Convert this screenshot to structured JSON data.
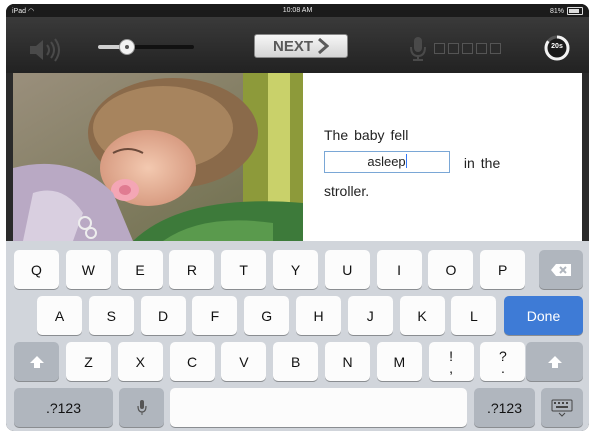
{
  "status_bar": {
    "carrier": "iPad",
    "time": "10:08 AM",
    "battery": "81%"
  },
  "toolbar": {
    "next_label": "NEXT",
    "volume_level": 0.3,
    "mic_level_boxes": 5,
    "timer_label": "20s",
    "timer_progress": 0.85
  },
  "exercise": {
    "words_before": [
      "The",
      "baby",
      "fell"
    ],
    "answer_value": "asleep",
    "words_after": [
      "in",
      "the"
    ],
    "line3": "stroller."
  },
  "keyboard": {
    "row1": [
      "Q",
      "W",
      "E",
      "R",
      "T",
      "Y",
      "U",
      "I",
      "O",
      "P"
    ],
    "row2": [
      "A",
      "S",
      "D",
      "F",
      "G",
      "H",
      "J",
      "K",
      "L"
    ],
    "done_label": "Done",
    "row3": [
      "Z",
      "X",
      "C",
      "V",
      "B",
      "N",
      "M"
    ],
    "row3_punct": [
      [
        "!",
        ","
      ],
      [
        "?",
        "."
      ]
    ],
    "numbers_label": ".?123"
  },
  "colors": {
    "done_key": "#3e7bd6",
    "keyboard_bg": "#d1d5db",
    "toolbar_bg": "#2a2a2a"
  }
}
